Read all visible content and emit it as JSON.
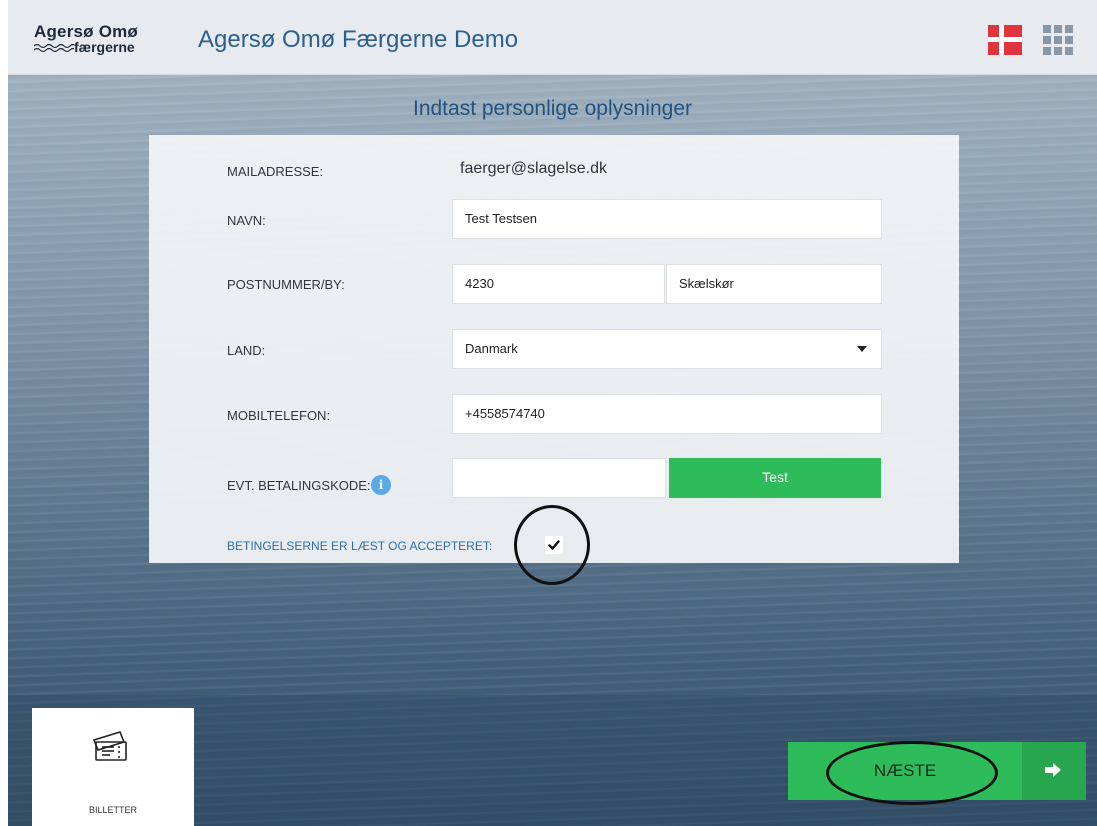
{
  "header": {
    "logo_line1": "Agersø Omø",
    "logo_line2": "færgerne",
    "title": "Agersø Omø Færgerne Demo",
    "language_flag": "danish-flag-icon",
    "menu_icon": "grid-menu-icon"
  },
  "page": {
    "heading": "Indtast personlige oplysninger"
  },
  "form": {
    "email_label": "MAILADRESSE:",
    "email_value": "faerger@slagelse.dk",
    "name_label": "NAVN:",
    "name_value": "Test Testsen",
    "postal_label": "POSTNUMMER/BY:",
    "postal_code_value": "4230",
    "city_value": "Skælskør",
    "country_label": "LAND:",
    "country_value": "Danmark",
    "mobile_label": "MOBILTELEFON:",
    "mobile_value": "+4558574740",
    "payment_code_label": "EVT. BETALINGSKODE:",
    "payment_code_value": "",
    "info_icon_glyph": "i",
    "test_button": "Test",
    "terms_label": "BETINGELSERNE ER LÆST OG ACCEPTERET:",
    "terms_checked": true
  },
  "bottom": {
    "tile_label": "BILLETTER",
    "next_button": "NÆSTE"
  },
  "colors": {
    "accent_green": "#2ebc5a",
    "title_blue": "#2a5f8e",
    "link_blue": "#2d6ea6"
  }
}
